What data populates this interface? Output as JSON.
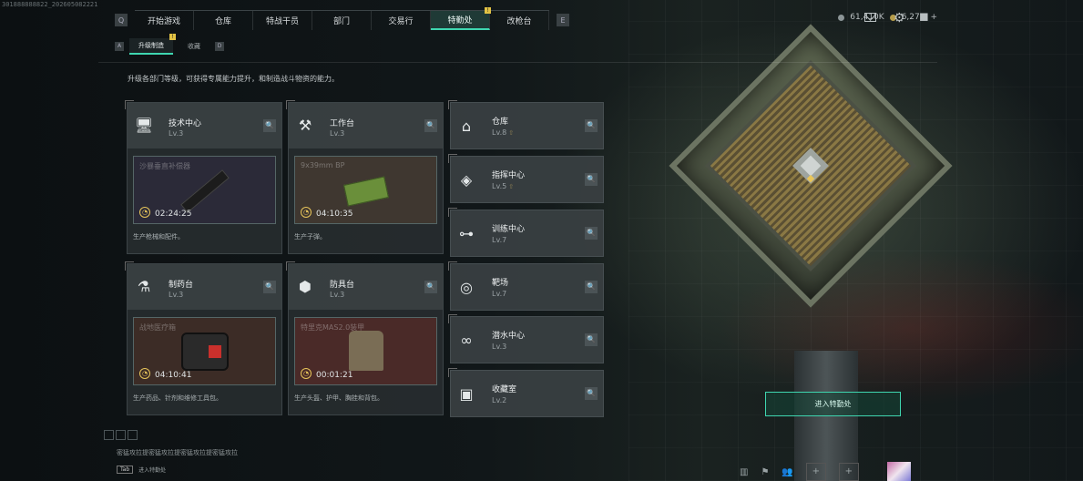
{
  "watermark": "301888888822_202605082221",
  "nav": {
    "tabs": [
      {
        "label": "开始游戏"
      },
      {
        "label": "仓库"
      },
      {
        "label": "特战干员"
      },
      {
        "label": "部门"
      },
      {
        "label": "交易行"
      },
      {
        "label": "特勤处",
        "active": true,
        "badge": "!"
      },
      {
        "label": "改枪台"
      }
    ],
    "prev_key": "Q",
    "next_key": "E"
  },
  "topbar": {
    "currency1": "61,410K",
    "currency2": "6,273",
    "plus": "+"
  },
  "subnav": {
    "prev_key": "A",
    "next_key": "D",
    "tabs": [
      {
        "label": "升级制造",
        "active": true,
        "badge": "!"
      },
      {
        "label": "收藏"
      }
    ]
  },
  "description": "升级各部门等级，可获得专属能力提升，和制造战斗物资的能力。",
  "production_cards": [
    {
      "name": "技术中心",
      "level": "Lv.3",
      "icon": "monitor-icon",
      "item": "沙暴垂直补偿器",
      "timer": "02:24:25",
      "desc": "生产枪械和配件。",
      "color": "#2b2a38"
    },
    {
      "name": "工作台",
      "level": "Lv.3",
      "icon": "tools-icon",
      "item": "9x39mm BP",
      "timer": "04:10:35",
      "desc": "生产子弹。",
      "color": "#3f3730"
    },
    {
      "name": "制药台",
      "level": "Lv.3",
      "icon": "microscope-icon",
      "item": "战地医疗箱",
      "timer": "04:10:41",
      "desc": "生产药品、针剂和维修工具包。",
      "color": "#3c2c26"
    },
    {
      "name": "防具台",
      "level": "Lv.3",
      "icon": "armor-parts-icon",
      "item": "特里克MAS2.0装甲",
      "timer": "00:01:21",
      "desc": "生产头盔、护甲、胸挂和背包。",
      "color": "#4a2a28"
    }
  ],
  "facility_list": [
    {
      "name": "仓库",
      "level": "Lv.8",
      "icon": "warehouse-icon",
      "upgradeable": true
    },
    {
      "name": "指挥中心",
      "level": "Lv.5",
      "icon": "command-icon",
      "upgradeable": true
    },
    {
      "name": "训练中心",
      "level": "Lv.7",
      "icon": "dumbbell-icon",
      "upgradeable": false
    },
    {
      "name": "靶场",
      "level": "Lv.7",
      "icon": "target-icon",
      "upgradeable": false
    },
    {
      "name": "潜水中心",
      "level": "Lv.3",
      "icon": "diving-icon",
      "upgradeable": false
    },
    {
      "name": "收藏室",
      "level": "Lv.2",
      "icon": "collection-icon",
      "upgradeable": false
    }
  ],
  "enter_button": "进入特勤处",
  "bottom_text": "密猛攻拉提密猛攻拉提密猛攻拉提密猛攻拉",
  "tab_hint": {
    "key": "Tab",
    "label": "进入特勤处"
  },
  "colors": {
    "accent": "#3fd6b0",
    "badge": "#e2c244",
    "timer": "#e8c55a"
  }
}
